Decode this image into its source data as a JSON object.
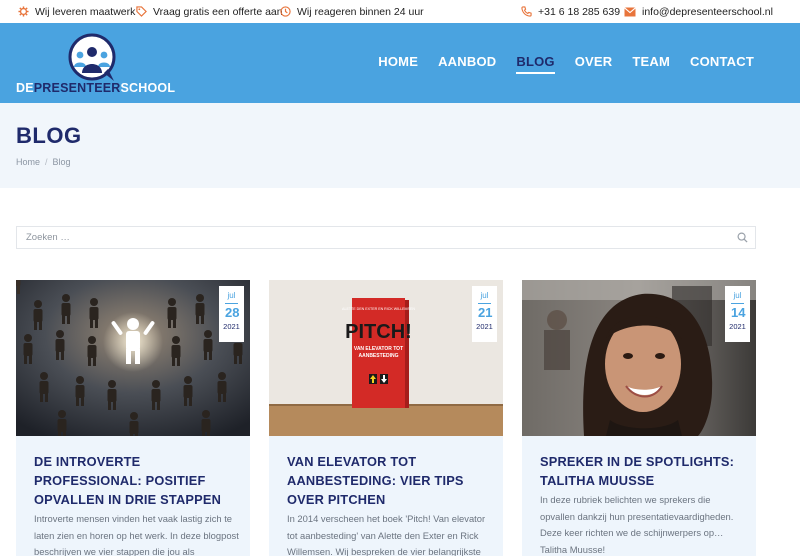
{
  "topbar": {
    "usp1": "Wij leveren maatwerk",
    "usp2": "Vraag gratis een offerte aan",
    "usp3": "Wij reageren binnen 24 uur",
    "phone": "+31 6 18 285 639",
    "email": "info@depresenteerschool.nl"
  },
  "logo": {
    "part1": "DE",
    "part2": "PRESENTEER",
    "part3": "SCHOOL"
  },
  "nav": [
    "HOME",
    "AANBOD",
    "BLOG",
    "OVER",
    "TEAM",
    "CONTACT"
  ],
  "page": {
    "title": "BLOG",
    "breadcrumb": {
      "home": "Home",
      "sep": "/",
      "current": "Blog"
    }
  },
  "search": {
    "placeholder": "Zoeken …"
  },
  "posts": [
    {
      "month": "jul",
      "day": "28",
      "year": "2021",
      "title": "DE INTROVERTE PROFESSIONAL: POSITIEF OPVALLEN IN DRIE STAPPEN",
      "excerpt": "Introverte mensen vinden het vaak lastig zich te laten zien en horen op het werk. In deze blogpost beschrijven we vier stappen die jou als"
    },
    {
      "month": "jul",
      "day": "21",
      "year": "2021",
      "title": "VAN ELEVATOR TOT AANBESTEDING: VIER TIPS OVER PITCHEN",
      "excerpt": "In 2014 verscheen het boek 'Pitch! Van elevator tot aanbesteding' van Alette den Exter en Rick Willemsen. Wij bespreken de vier belangrijkste",
      "book": {
        "authors": "ALETTE DEN EXTER EN RICK WILLEMSEN",
        "title": "PITCH!",
        "subtitle1": "VAN ELEVATOR TOT",
        "subtitle2": "AANBESTEDING"
      }
    },
    {
      "month": "jul",
      "day": "14",
      "year": "2021",
      "title": "SPREKER IN DE SPOTLIGHTS: TALITHA MUUSSE",
      "excerpt": "In deze rubriek belichten we sprekers die opvallen dankzij hun presentatievaardigheden. Deze keer richten we de schijnwerpers op… Talitha Muusse!"
    }
  ],
  "colors": {
    "header": "#4aa3e0",
    "navy": "#1f2a6b",
    "accent": "#e8743b",
    "card_bg": "#eef5fc"
  }
}
